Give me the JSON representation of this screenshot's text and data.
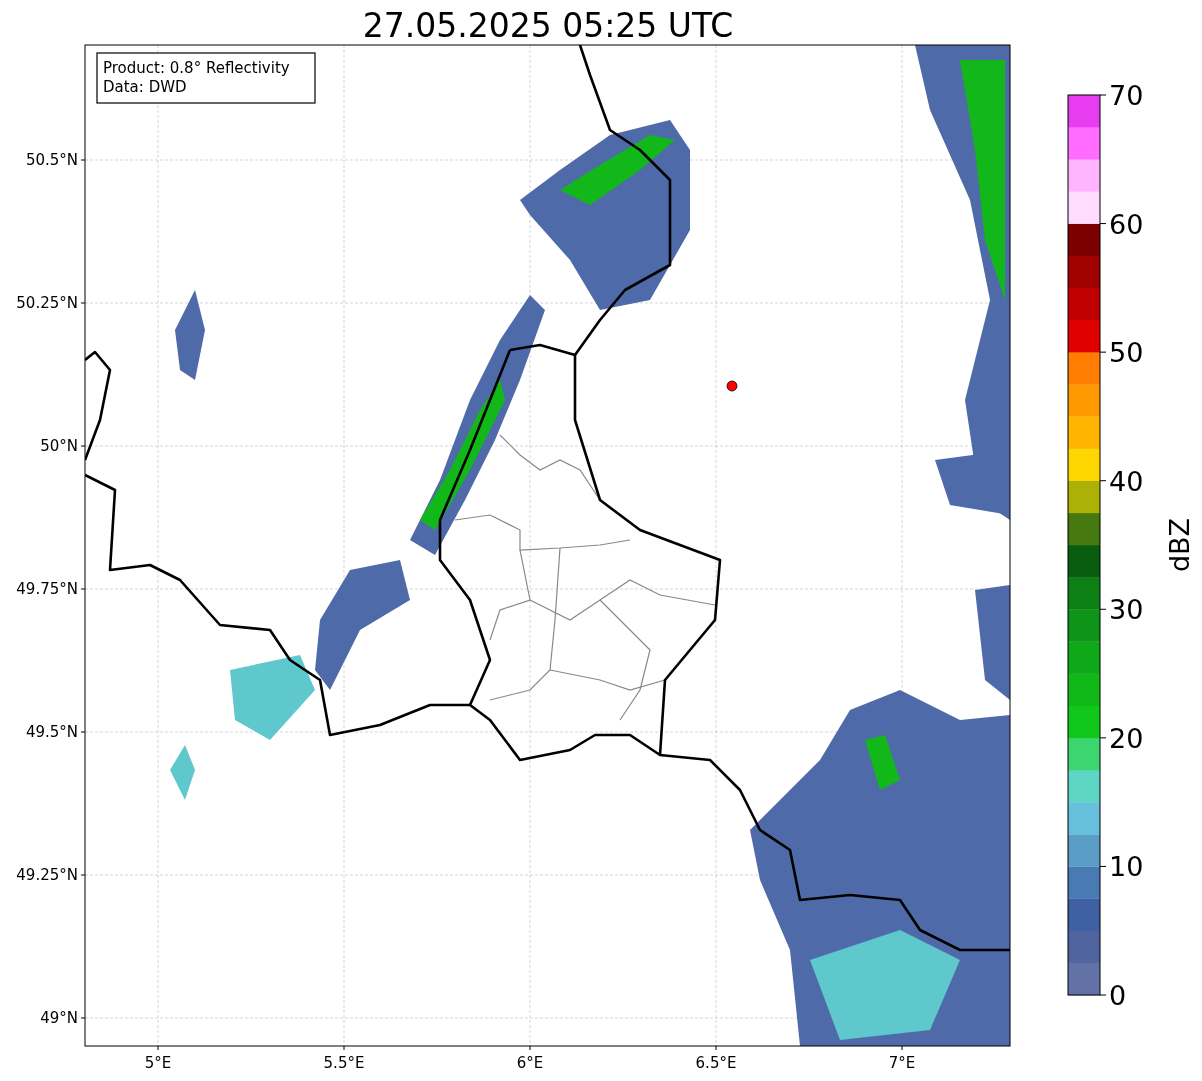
{
  "title": "27.05.2025 05:25 UTC",
  "legend": [
    "Product: 0.8° Reflectivity",
    "Data: DWD"
  ],
  "y_ticks": [
    "50.5°N",
    "50.25°N",
    "50°N",
    "49.75°N",
    "49.5°N",
    "49.25°N",
    "49°N"
  ],
  "x_ticks": [
    "5°E",
    "5.5°E",
    "6°E",
    "6.5°E",
    "7°E"
  ],
  "colorbar": {
    "label": "dBZ",
    "ticks": [
      "70",
      "60",
      "50",
      "40",
      "30",
      "20",
      "10",
      "0"
    ],
    "levels": [
      {
        "color": "#6272a6"
      },
      {
        "color": "#5064a0"
      },
      {
        "color": "#4060a4"
      },
      {
        "color": "#4a7ab4"
      },
      {
        "color": "#5a9ec8"
      },
      {
        "color": "#66c0dc"
      },
      {
        "color": "#5ed6c4"
      },
      {
        "color": "#3cd670"
      },
      {
        "color": "#10c81a"
      },
      {
        "color": "#10b818"
      },
      {
        "color": "#0fa818"
      },
      {
        "color": "#0e9418"
      },
      {
        "color": "#0c8014"
      },
      {
        "color": "#085e0e"
      },
      {
        "color": "#467a10"
      },
      {
        "color": "#adb005"
      },
      {
        "color": "#ffd700"
      },
      {
        "color": "#ffb500"
      },
      {
        "color": "#ff9900"
      },
      {
        "color": "#ff7d00"
      },
      {
        "color": "#e00000"
      },
      {
        "color": "#c00000"
      },
      {
        "color": "#a00000"
      },
      {
        "color": "#7c0000"
      },
      {
        "color": "#ffdcff"
      },
      {
        "color": "#ffb4ff"
      },
      {
        "color": "#ff6cff"
      },
      {
        "color": "#e83cf0"
      }
    ]
  }
}
